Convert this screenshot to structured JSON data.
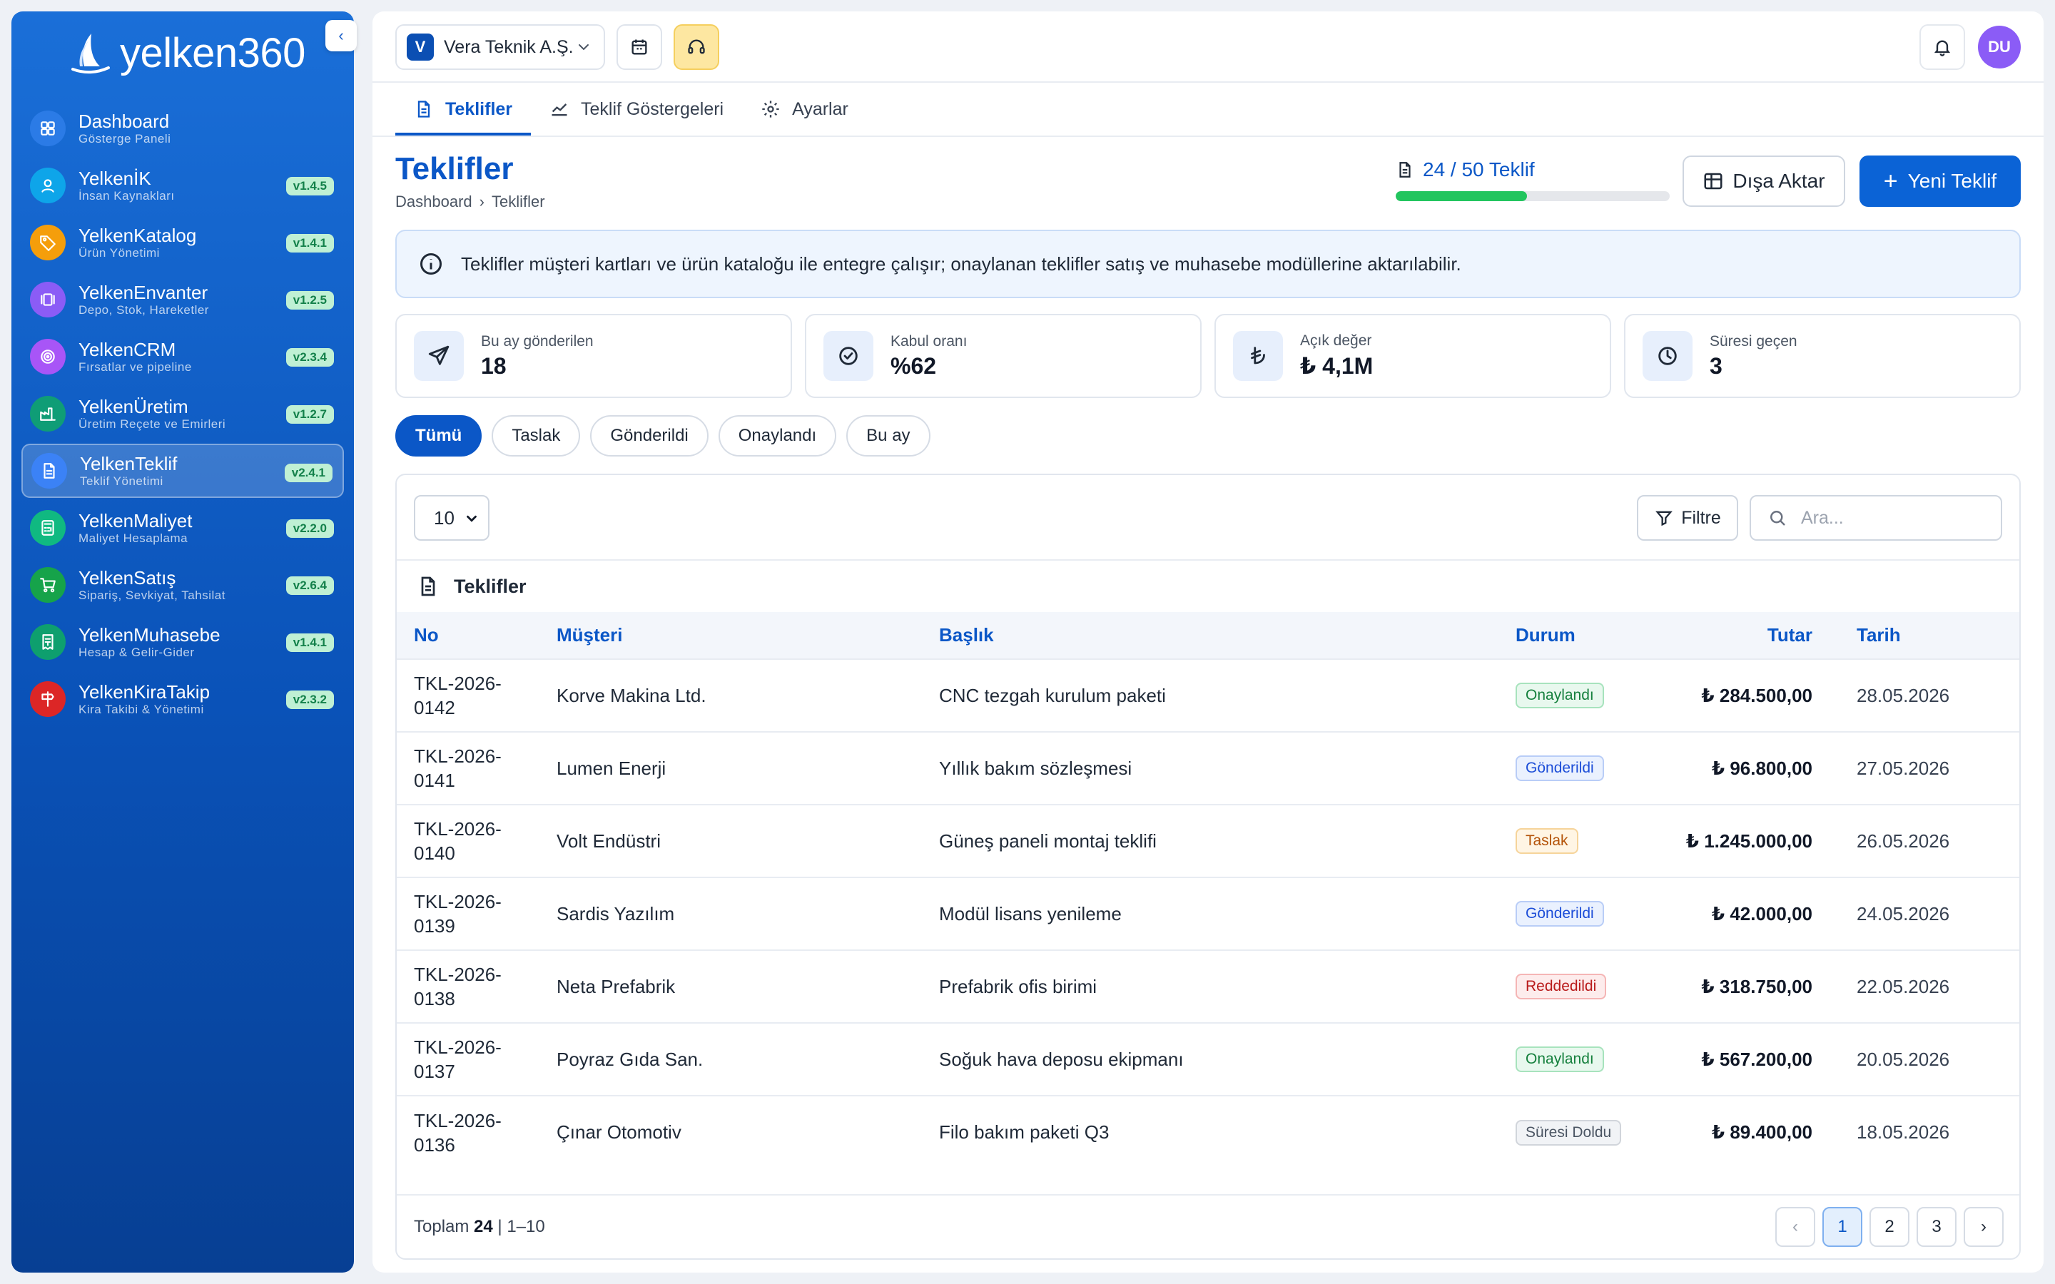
{
  "app": {
    "logo_text": "yelken360",
    "collapse_glyph": "‹"
  },
  "sidebar": {
    "items": [
      {
        "title": "Dashboard",
        "sub": "Gösterge Paneli",
        "version": "",
        "color": "#2b7be6",
        "icon": "grid-icon"
      },
      {
        "title": "YelkenİK",
        "sub": "İnsan Kaynakları",
        "version": "v1.4.5",
        "color": "#0ea5e9",
        "icon": "user-icon"
      },
      {
        "title": "YelkenKatalog",
        "sub": "Ürün Yönetimi",
        "version": "v1.4.1",
        "color": "#f59e0b",
        "icon": "tag-icon"
      },
      {
        "title": "YelkenEnvanter",
        "sub": "Depo, Stok, Hareketler",
        "version": "v1.2.5",
        "color": "#8b5cf6",
        "icon": "stack-icon"
      },
      {
        "title": "YelkenCRM",
        "sub": "Fırsatlar ve pipeline",
        "version": "v2.3.4",
        "color": "#a855f7",
        "icon": "target-icon"
      },
      {
        "title": "YelkenÜretim",
        "sub": "Üretim Reçete ve Emirleri",
        "version": "v1.2.7",
        "color": "#0f9d76",
        "icon": "factory-icon"
      },
      {
        "title": "YelkenTeklif",
        "sub": "Teklif Yönetimi",
        "version": "v2.4.1",
        "color": "#3b82f6",
        "icon": "document-icon"
      },
      {
        "title": "YelkenMaliyet",
        "sub": "Maliyet Hesaplama",
        "version": "v2.2.0",
        "color": "#10b981",
        "icon": "calculator-icon"
      },
      {
        "title": "YelkenSatış",
        "sub": "Sipariş, Sevkiyat, Tahsilat",
        "version": "v2.6.4",
        "color": "#16a34a",
        "icon": "cart-icon"
      },
      {
        "title": "YelkenMuhasebe",
        "sub": "Hesap & Gelir-Gider",
        "version": "v1.4.1",
        "color": "#0e9f6e",
        "icon": "receipt-icon"
      },
      {
        "title": "YelkenKiraTakip",
        "sub": "Kira Takibi & Yönetimi",
        "version": "v2.3.2",
        "color": "#dc2626",
        "icon": "sign-icon"
      }
    ]
  },
  "topbar": {
    "company_initial": "V",
    "company_name": "Vera Teknik A.Ş.",
    "user_initials": "DU"
  },
  "tabs": [
    "Teklifler",
    "Teklif Göstergeleri",
    "Ayarlar"
  ],
  "page": {
    "title": "Teklifler",
    "breadcrumb": [
      "Dashboard",
      "›",
      "Teklifler"
    ],
    "quota_label": "24 / 50 Teklif",
    "quota_fraction": 0.48,
    "export_label": "Dışa Aktar",
    "new_label": "Yeni Teklif",
    "info_text": "Teklifler müşteri kartları ve ürün kataloğu ile entegre çalışır; onaylanan teklifler satış ve muhasebe modüllerine aktarılabilir."
  },
  "stats": [
    {
      "label": "Bu ay gönderilen",
      "value": "18",
      "icon": "send-icon"
    },
    {
      "label": "Kabul oranı",
      "value": "%62",
      "icon": "check-circle-icon"
    },
    {
      "label": "Açık değer",
      "value": "₺ 4,1M",
      "icon": "lira-icon"
    },
    {
      "label": "Süresi geçen",
      "value": "3",
      "icon": "clock-icon"
    }
  ],
  "filters": [
    "Tümü",
    "Taslak",
    "Gönderildi",
    "Onaylandı",
    "Bu ay"
  ],
  "table_tools": {
    "page_size": "10",
    "filter_label": "Filtre",
    "search_placeholder": "Ara..."
  },
  "table": {
    "title": "Teklifler",
    "columns": [
      "No",
      "Müşteri",
      "Başlık",
      "Durum",
      "Tutar",
      "Tarih"
    ],
    "rows": [
      {
        "no1": "TKL-2026-",
        "no2": "0142",
        "customer": "Korve Makina Ltd.",
        "title": "CNC tezgah kurulum paketi",
        "status": "Onaylandı",
        "status_class": "b-onay",
        "amount": "₺ 284.500,00",
        "date": "28.05.2026"
      },
      {
        "no1": "TKL-2026-",
        "no2": "0141",
        "customer": "Lumen Enerji",
        "title": "Yıllık bakım sözleşmesi",
        "status": "Gönderildi",
        "status_class": "b-gond",
        "amount": "₺ 96.800,00",
        "date": "27.05.2026"
      },
      {
        "no1": "TKL-2026-",
        "no2": "0140",
        "customer": "Volt Endüstri",
        "title": "Güneş paneli montaj teklifi",
        "status": "Taslak",
        "status_class": "b-tas",
        "amount": "₺ 1.245.000,00",
        "date": "26.05.2026"
      },
      {
        "no1": "TKL-2026-",
        "no2": "0139",
        "customer": "Sardis Yazılım",
        "title": "Modül lisans yenileme",
        "status": "Gönderildi",
        "status_class": "b-gond",
        "amount": "₺ 42.000,00",
        "date": "24.05.2026"
      },
      {
        "no1": "TKL-2026-",
        "no2": "0138",
        "customer": "Neta Prefabrik",
        "title": "Prefabrik ofis birimi",
        "status": "Reddedildi",
        "status_class": "b-red",
        "amount": "₺ 318.750,00",
        "date": "22.05.2026"
      },
      {
        "no1": "TKL-2026-",
        "no2": "0137",
        "customer": "Poyraz Gıda San.",
        "title": "Soğuk hava deposu ekipmanı",
        "status": "Onaylandı",
        "status_class": "b-onay",
        "amount": "₺ 567.200,00",
        "date": "20.05.2026"
      },
      {
        "no1": "TKL-2026-",
        "no2": "0136",
        "customer": "Çınar Otomotiv",
        "title": "Filo bakım paketi Q3",
        "status": "Süresi Doldu",
        "status_class": "b-sur",
        "amount": "₺ 89.400,00",
        "date": "18.05.2026"
      }
    ]
  },
  "footer": {
    "total_prefix": "Toplam",
    "total_count": "24",
    "range": "| 1–10",
    "pages": [
      "‹",
      "1",
      "2",
      "3",
      "›"
    ],
    "active_page": "1"
  }
}
